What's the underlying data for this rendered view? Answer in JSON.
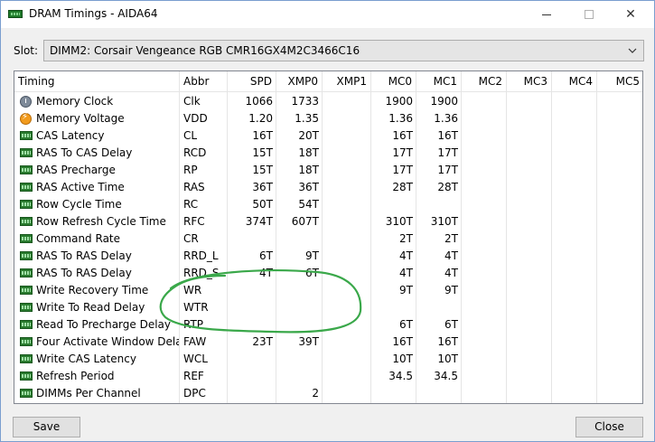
{
  "window": {
    "title": "DRAM Timings - AIDA64",
    "accent": "#1f7a2a"
  },
  "slot": {
    "label": "Slot:",
    "value": "DIMM2: Corsair Vengeance RGB CMR16GX4M2C3466C16"
  },
  "table": {
    "columns": [
      "Timing",
      "Abbr",
      "SPD",
      "XMP0",
      "XMP1",
      "MC0",
      "MC1",
      "MC2",
      "MC3",
      "MC4",
      "MC5"
    ],
    "rows": [
      {
        "icon": "clock-icon",
        "name": "Memory Clock",
        "abbr": "Clk",
        "spd": "1066",
        "xmp0": "1733",
        "xmp1": "",
        "mc0": "1900",
        "mc1": "1900"
      },
      {
        "icon": "voltage-icon",
        "name": "Memory Voltage",
        "abbr": "VDD",
        "spd": "1.20",
        "xmp0": "1.35",
        "xmp1": "",
        "mc0": "1.36",
        "mc1": "1.36"
      },
      {
        "icon": "ram-module-icon",
        "name": "CAS Latency",
        "abbr": "CL",
        "spd": "16T",
        "xmp0": "20T",
        "xmp1": "",
        "mc0": "16T",
        "mc1": "16T"
      },
      {
        "icon": "ram-module-icon",
        "name": "RAS To CAS Delay",
        "abbr": "RCD",
        "spd": "15T",
        "xmp0": "18T",
        "xmp1": "",
        "mc0": "17T",
        "mc1": "17T"
      },
      {
        "icon": "ram-module-icon",
        "name": "RAS Precharge",
        "abbr": "RP",
        "spd": "15T",
        "xmp0": "18T",
        "xmp1": "",
        "mc0": "17T",
        "mc1": "17T"
      },
      {
        "icon": "ram-module-icon",
        "name": "RAS Active Time",
        "abbr": "RAS",
        "spd": "36T",
        "xmp0": "36T",
        "xmp1": "",
        "mc0": "28T",
        "mc1": "28T"
      },
      {
        "icon": "ram-module-icon",
        "name": "Row Cycle Time",
        "abbr": "RC",
        "spd": "50T",
        "xmp0": "54T",
        "xmp1": "",
        "mc0": "",
        "mc1": ""
      },
      {
        "icon": "ram-module-icon",
        "name": "Row Refresh Cycle Time",
        "abbr": "RFC",
        "spd": "374T",
        "xmp0": "607T",
        "xmp1": "",
        "mc0": "310T",
        "mc1": "310T"
      },
      {
        "icon": "ram-module-icon",
        "name": "Command Rate",
        "abbr": "CR",
        "spd": "",
        "xmp0": "",
        "xmp1": "",
        "mc0": "2T",
        "mc1": "2T"
      },
      {
        "icon": "ram-module-icon",
        "name": "RAS To RAS Delay",
        "abbr": "RRD_L",
        "spd": "6T",
        "xmp0": "9T",
        "xmp1": "",
        "mc0": "4T",
        "mc1": "4T"
      },
      {
        "icon": "ram-module-icon",
        "name": "RAS To RAS Delay",
        "abbr": "RRD_S",
        "spd": "4T",
        "xmp0": "6T",
        "xmp1": "",
        "mc0": "4T",
        "mc1": "4T"
      },
      {
        "icon": "ram-module-icon",
        "name": "Write Recovery Time",
        "abbr": "WR",
        "spd": "",
        "xmp0": "",
        "xmp1": "",
        "mc0": "9T",
        "mc1": "9T"
      },
      {
        "icon": "ram-module-icon",
        "name": "Write To Read Delay",
        "abbr": "WTR",
        "spd": "",
        "xmp0": "",
        "xmp1": "",
        "mc0": "",
        "mc1": ""
      },
      {
        "icon": "ram-module-icon",
        "name": "Read To Precharge Delay",
        "abbr": "RTP",
        "spd": "",
        "xmp0": "",
        "xmp1": "",
        "mc0": "6T",
        "mc1": "6T"
      },
      {
        "icon": "ram-module-icon",
        "name": "Four Activate Window Delay",
        "abbr": "FAW",
        "spd": "23T",
        "xmp0": "39T",
        "xmp1": "",
        "mc0": "16T",
        "mc1": "16T"
      },
      {
        "icon": "ram-module-icon",
        "name": "Write CAS Latency",
        "abbr": "WCL",
        "spd": "",
        "xmp0": "",
        "xmp1": "",
        "mc0": "10T",
        "mc1": "10T"
      },
      {
        "icon": "ram-module-icon",
        "name": "Refresh Period",
        "abbr": "REF",
        "spd": "",
        "xmp0": "",
        "xmp1": "",
        "mc0": "34.5",
        "mc1": "34.5"
      },
      {
        "icon": "ram-module-icon",
        "name": "DIMMs Per Channel",
        "abbr": "DPC",
        "spd": "",
        "xmp0": "2",
        "xmp1": "",
        "mc0": "",
        "mc1": ""
      }
    ]
  },
  "buttons": {
    "save": "Save",
    "close": "Close"
  },
  "annotation": {
    "color": "#3aa84a"
  }
}
